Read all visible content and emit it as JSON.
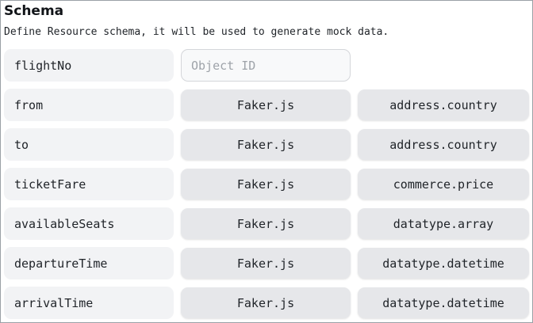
{
  "schema": {
    "title": "Schema",
    "description": "Define Resource schema, it will be used to generate mock data.",
    "id_field": {
      "name": "flightNo",
      "placeholder": "Object ID",
      "value": ""
    },
    "fields": [
      {
        "name": "from",
        "generator": "Faker.js",
        "method": "address.country"
      },
      {
        "name": "to",
        "generator": "Faker.js",
        "method": "address.country"
      },
      {
        "name": "ticketFare",
        "generator": "Faker.js",
        "method": "commerce.price"
      },
      {
        "name": "availableSeats",
        "generator": "Faker.js",
        "method": "datatype.array"
      },
      {
        "name": "departureTime",
        "generator": "Faker.js",
        "method": "datatype.datetime"
      },
      {
        "name": "arrivalTime",
        "generator": "Faker.js",
        "method": "datatype.datetime"
      }
    ]
  }
}
